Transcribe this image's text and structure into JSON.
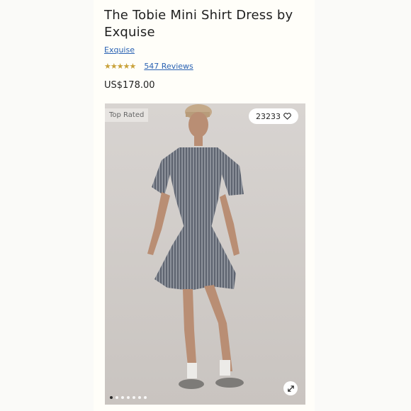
{
  "product": {
    "title": "The Tobie Mini Shirt Dress by Exquise",
    "brand": "Exquise",
    "rating_stars": "★★★★★",
    "reviews": "547 Reviews",
    "price": "US$178.00"
  },
  "image": {
    "badge": "Top Rated",
    "likes": "23233",
    "heart_icon": "heart-icon",
    "expand_icon": "expand-icon",
    "dot_count": 7,
    "active_dot": 1
  },
  "colors": {
    "link": "#2a62b3",
    "star": "#c9a23a",
    "photo_bg": "#d2cecb"
  }
}
